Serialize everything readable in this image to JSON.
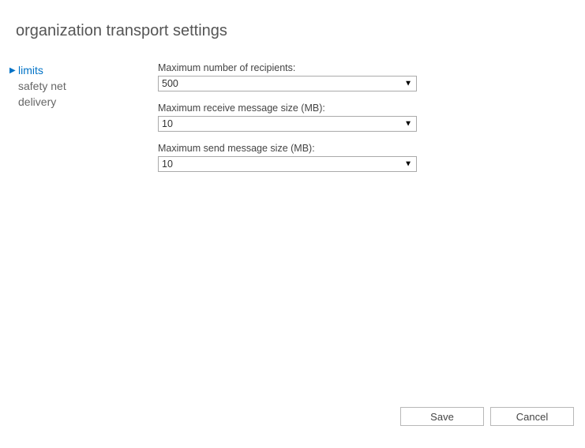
{
  "title": "organization transport settings",
  "sidebar": {
    "items": [
      {
        "label": "limits",
        "active": true
      },
      {
        "label": "safety net",
        "active": false
      },
      {
        "label": "delivery",
        "active": false
      }
    ]
  },
  "form": {
    "max_recipients": {
      "label": "Maximum number of recipients:",
      "value": "500"
    },
    "max_receive_size": {
      "label": "Maximum receive message size (MB):",
      "value": "10"
    },
    "max_send_size": {
      "label": "Maximum send message size (MB):",
      "value": "10"
    }
  },
  "footer": {
    "save_label": "Save",
    "cancel_label": "Cancel"
  }
}
